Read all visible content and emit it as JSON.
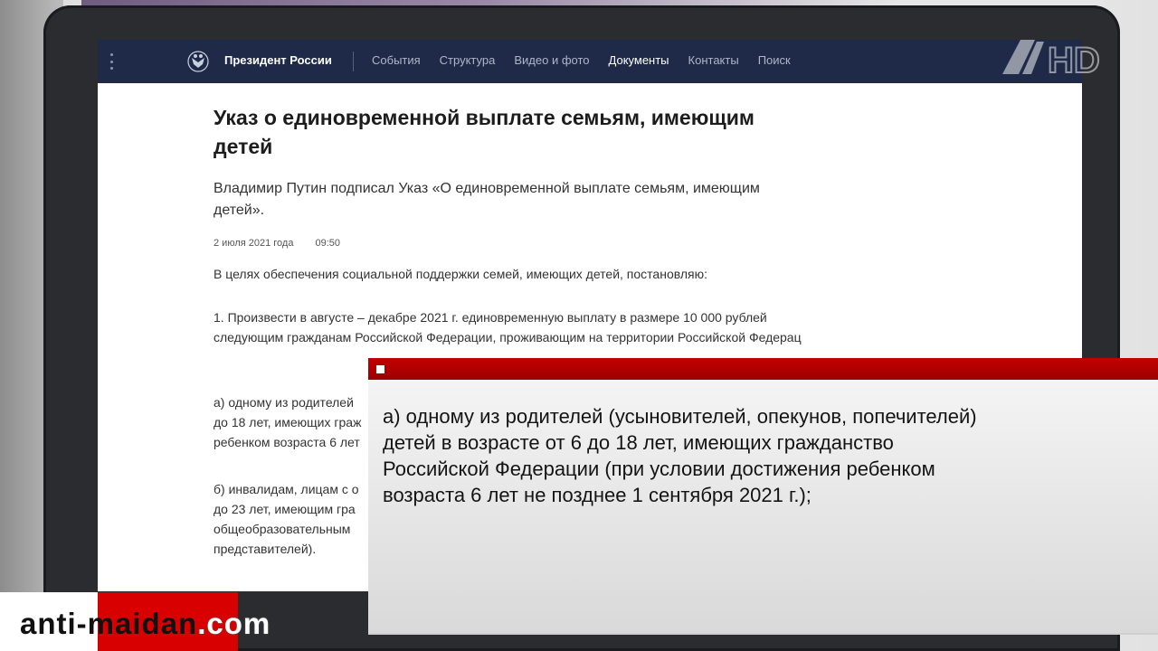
{
  "navbar": {
    "brand": "Президент России",
    "items": [
      "События",
      "Структура",
      "Видео и фото",
      "Документы",
      "Контакты",
      "Поиск"
    ],
    "active_index": 3
  },
  "article": {
    "title": "Указ о единовременной выплате семьям, имеющим детей",
    "lead": "Владимир Путин подписал Указ «О единовременной выплате семьям, имеющим детей».",
    "date": "2 июля 2021 года",
    "time": "09:50",
    "p1": "В целях обеспечения социальной поддержки семей, имеющих детей, постановляю:",
    "p2": "1. Произвести в августе – декабре 2021 г. единовременную выплату в размере 10 000 рублей следующим гражданам Российской Федерации, проживающим на территории Российской Федерац",
    "p3_l1": "а) одному из родителей",
    "p3_l2": "до 18 лет, имеющих граж",
    "p3_l3": "ребенком возраста 6 лет",
    "p4_l1": "б) инвалидам, лицам с о",
    "p4_l2": "до 23 лет, имеющим гра",
    "p4_l3": "общеобразовательным",
    "p4_l4": "представителей)."
  },
  "caption": {
    "text": "а) одному из родителей (усыновителей, опекунов, попечителей) детей в возрасте от 6 до 18 лет, имеющих гражданство Российской Федерации (при условии достижения ребенком возраста 6 лет не позднее 1 сентября 2021 г.);"
  },
  "watermark": {
    "part1": "anti-",
    "part2": "maidan",
    "part3": ".com"
  },
  "channel_logo": "1HD",
  "colors": {
    "navbar": "#1f2a48",
    "red_bar": "#c20000",
    "brand_red": "#d80000"
  }
}
